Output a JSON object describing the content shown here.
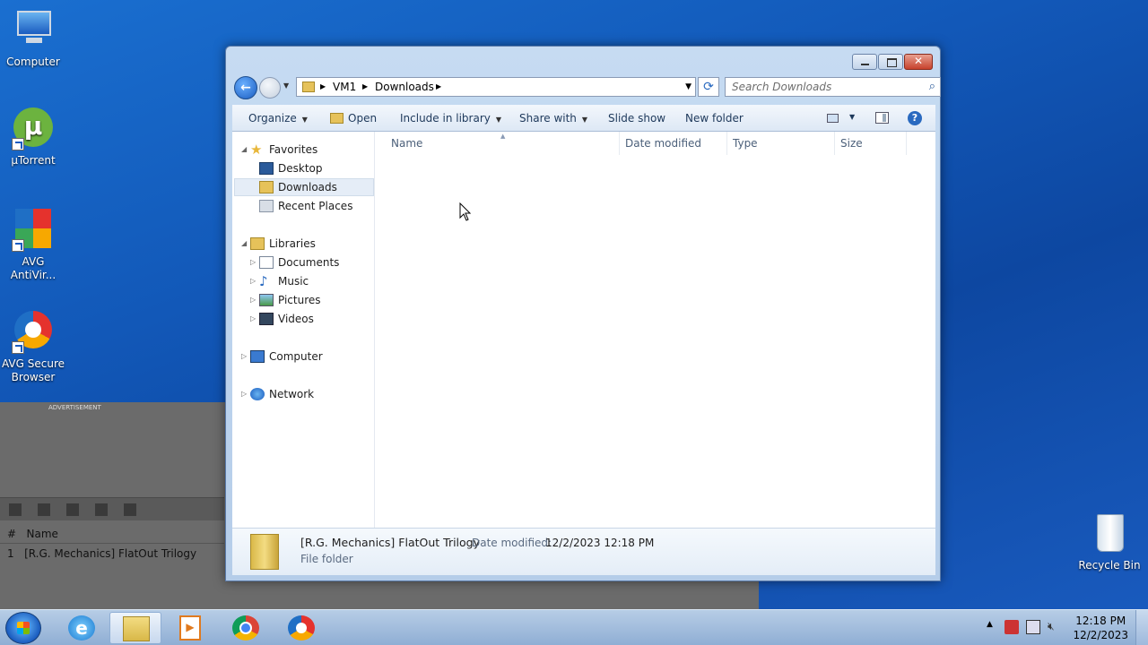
{
  "desktop": {
    "icons": [
      {
        "label": "Computer"
      },
      {
        "label": "µTorrent"
      },
      {
        "label": "AVG AntiVir..."
      },
      {
        "label": "AVG Secure Browser"
      },
      {
        "label": "Recycle Bin"
      }
    ]
  },
  "bg_app": {
    "ad_label": "ADVERTISEMENT",
    "col_num": "#",
    "col_name": "Name",
    "row_num": "1",
    "row_name": "[R.G. Mechanics] FlatOut Trilogy"
  },
  "explorer": {
    "address": {
      "crumbs": [
        "VM1",
        "Downloads"
      ]
    },
    "search": {
      "placeholder": "Search Downloads"
    },
    "toolbar": {
      "organize": "Organize",
      "open": "Open",
      "include_in_library": "Include in library",
      "share_with": "Share with",
      "slide_show": "Slide show",
      "new_folder": "New folder"
    },
    "nav": {
      "favorites": "Favorites",
      "desktop": "Desktop",
      "downloads": "Downloads",
      "recent_places": "Recent Places",
      "libraries": "Libraries",
      "documents": "Documents",
      "music": "Music",
      "pictures": "Pictures",
      "videos": "Videos",
      "computer": "Computer",
      "network": "Network"
    },
    "columns": {
      "name": "Name",
      "date_modified": "Date modified",
      "type": "Type",
      "size": "Size"
    },
    "details": {
      "name": "[R.G. Mechanics] FlatOut Trilogy",
      "date_label": "Date modified:",
      "date_value": "12/2/2023 12:18 PM",
      "type": "File folder"
    }
  },
  "taskbar": {
    "clock_time": "12:18 PM",
    "clock_date": "12/2/2023"
  }
}
